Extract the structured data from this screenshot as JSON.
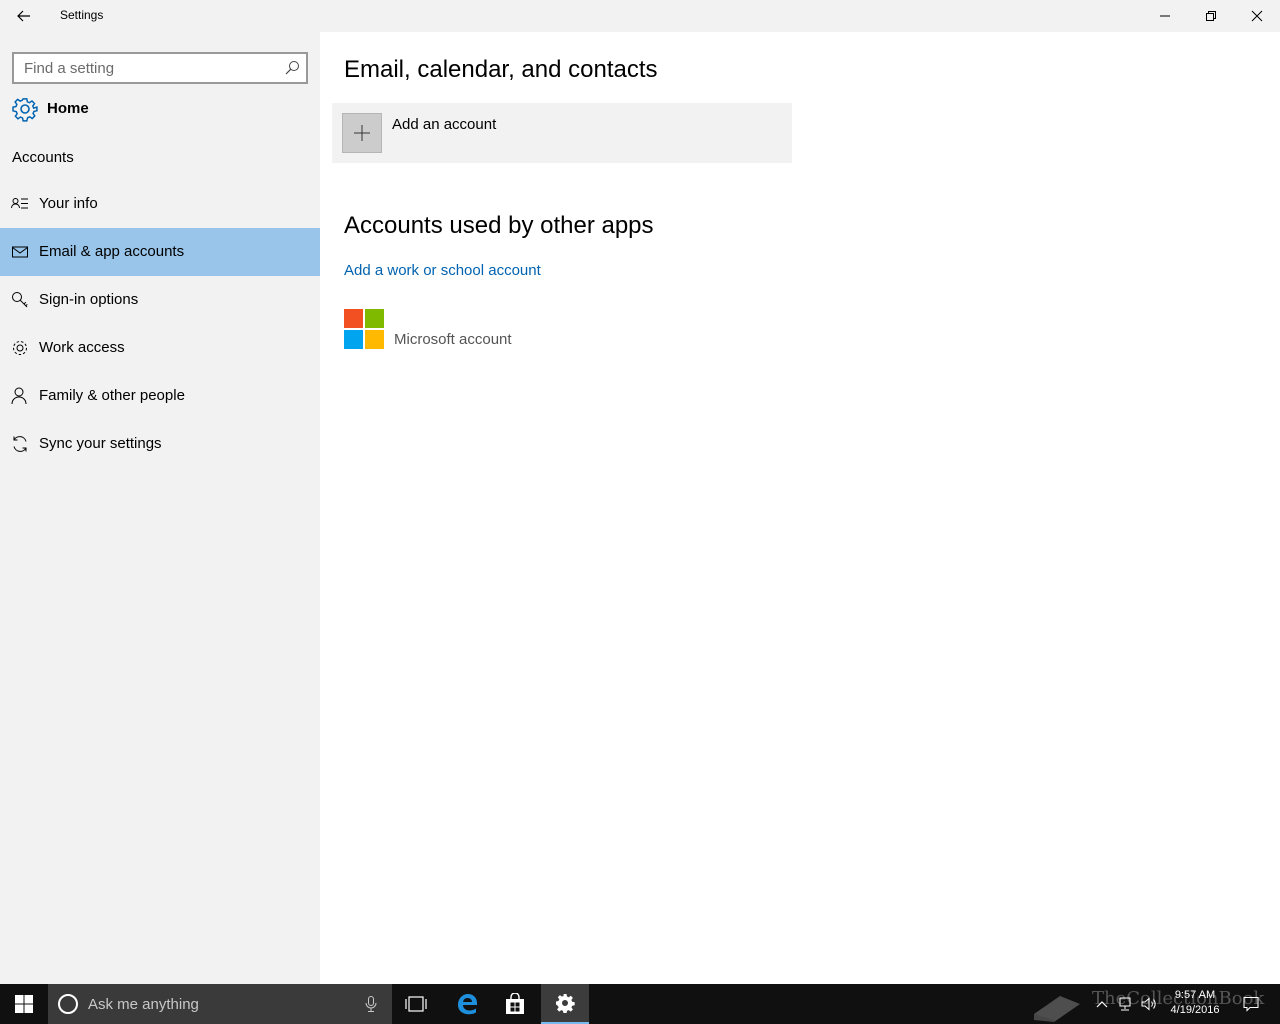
{
  "window": {
    "title": "Settings"
  },
  "sidebar": {
    "search_placeholder": "Find a setting",
    "home_label": "Home",
    "section_label": "Accounts",
    "items": [
      {
        "label": "Your info",
        "icon": "contact-card-icon"
      },
      {
        "label": "Email & app accounts",
        "icon": "mail-icon",
        "selected": true
      },
      {
        "label": "Sign-in options",
        "icon": "key-icon"
      },
      {
        "label": "Work access",
        "icon": "briefcase-gear-icon"
      },
      {
        "label": "Family & other people",
        "icon": "person-icon"
      },
      {
        "label": "Sync your settings",
        "icon": "sync-icon"
      }
    ]
  },
  "main": {
    "heading_email": "Email, calendar, and contacts",
    "add_account_label": "Add an account",
    "heading_other_apps": "Accounts used by other apps",
    "add_work_link": "Add a work or school account",
    "microsoft_account_label": "Microsoft account"
  },
  "taskbar": {
    "search_placeholder": "Ask me anything",
    "time": "9:57 AM",
    "date": "4/19/2016",
    "watermark": "TheCollectionBook"
  },
  "colors": {
    "accent": "#0063b1",
    "selected_bg": "#99c5ea",
    "sidebar_bg": "#f2f2f2",
    "taskbar_bg": "#101010",
    "ms_red": "#f25022",
    "ms_green": "#7fba00",
    "ms_blue": "#00a4ef",
    "ms_yellow": "#ffb900"
  }
}
